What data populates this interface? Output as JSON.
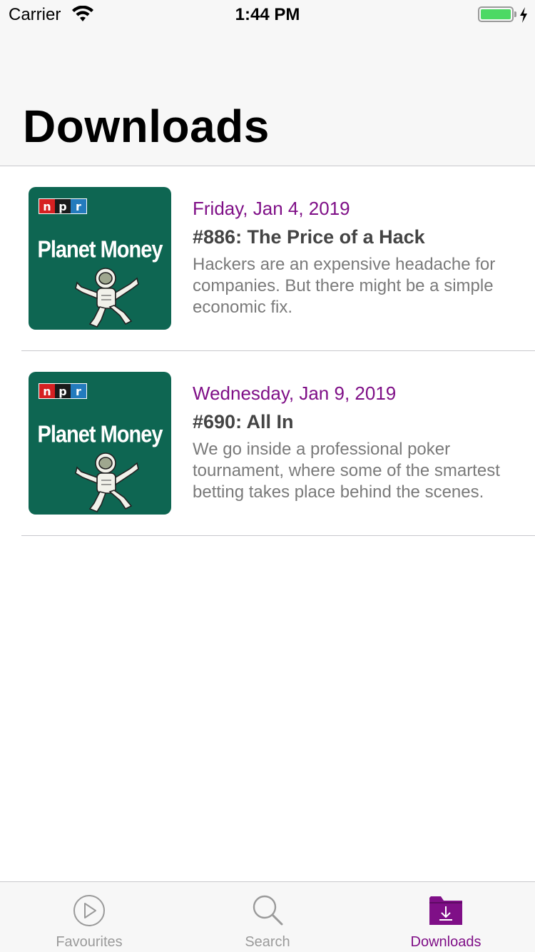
{
  "status_bar": {
    "carrier": "Carrier",
    "time": "1:44 PM",
    "battery_level": 1.0
  },
  "header": {
    "title": "Downloads"
  },
  "episodes": [
    {
      "artwork": {
        "npr_letters": [
          "n",
          "p",
          "r"
        ],
        "show_title": "Planet Money"
      },
      "date": "Friday, Jan 4, 2019",
      "title": "#886: The Price of a Hack",
      "description": "Hackers are an expensive headache for companies. But there might be a simple economic fix."
    },
    {
      "artwork": {
        "npr_letters": [
          "n",
          "p",
          "r"
        ],
        "show_title": "Planet Money"
      },
      "date": "Wednesday, Jan 9, 2019",
      "title": "#690: All In",
      "description": "We go inside a professional poker tournament, where some of the smartest betting takes place behind the scenes."
    }
  ],
  "tab_bar": {
    "tabs": [
      {
        "label": "Favourites",
        "icon": "play-circle-icon",
        "active": false
      },
      {
        "label": "Search",
        "icon": "search-icon",
        "active": false
      },
      {
        "label": "Downloads",
        "icon": "download-folder-icon",
        "active": true
      }
    ]
  },
  "colors": {
    "accent": "#7f0f87",
    "artwork_bg": "#0e6652",
    "title_text": "#444444",
    "description_text": "#7a7a7a",
    "inactive_tab": "#9a9a9a"
  }
}
